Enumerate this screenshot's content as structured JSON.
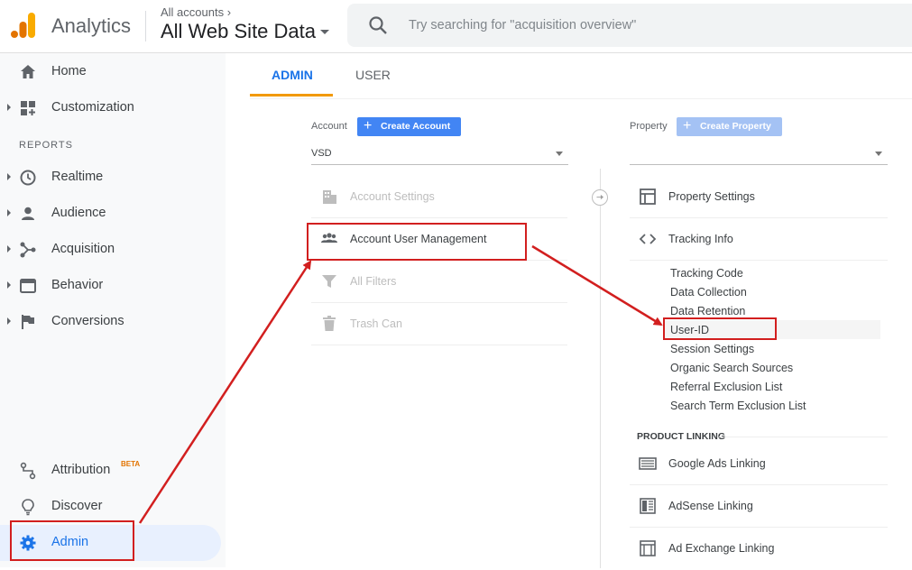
{
  "header": {
    "app_name": "Analytics",
    "account_crumb": "All accounts ›",
    "account_name": "All Web Site Data",
    "search_placeholder": "Try searching for \"acquisition overview\""
  },
  "sidebar": {
    "items": [
      {
        "label": "Home",
        "icon": "home-icon"
      },
      {
        "label": "Customization",
        "icon": "customization-icon"
      }
    ],
    "reports_label": "REPORTS",
    "reports": [
      {
        "label": "Realtime",
        "icon": "clock-icon"
      },
      {
        "label": "Audience",
        "icon": "person-icon"
      },
      {
        "label": "Acquisition",
        "icon": "acquisition-icon"
      },
      {
        "label": "Behavior",
        "icon": "behavior-icon"
      },
      {
        "label": "Conversions",
        "icon": "flag-icon"
      }
    ],
    "bottom": [
      {
        "label": "Attribution",
        "badge": "BETA",
        "icon": "attribution-icon"
      },
      {
        "label": "Discover",
        "icon": "lightbulb-icon"
      },
      {
        "label": "Admin",
        "icon": "gear-icon"
      }
    ]
  },
  "tabs": {
    "admin": "ADMIN",
    "user": "USER"
  },
  "account_column": {
    "label": "Account",
    "create_button": "Create Account",
    "selected": "VSD",
    "rows": [
      {
        "label": "Account Settings",
        "enabled": false
      },
      {
        "label": "Account User Management",
        "enabled": true
      },
      {
        "label": "All Filters",
        "enabled": false
      },
      {
        "label": "Trash Can",
        "enabled": false
      }
    ]
  },
  "property_column": {
    "label": "Property",
    "create_button": "Create Property",
    "selected": "",
    "rows": [
      {
        "label": "Property Settings"
      },
      {
        "label": "Tracking Info"
      }
    ],
    "tracking_items": [
      "Tracking Code",
      "Data Collection",
      "Data Retention",
      "User-ID",
      "Session Settings",
      "Organic Search Sources",
      "Referral Exclusion List",
      "Search Term Exclusion List"
    ],
    "product_linking_label": "PRODUCT LINKING",
    "linking_rows": [
      {
        "label": "Google Ads Linking"
      },
      {
        "label": "AdSense Linking"
      },
      {
        "label": "Ad Exchange Linking"
      }
    ]
  },
  "colors": {
    "accent_blue": "#1a73e8",
    "annotation_red": "#d21f1f",
    "tab_underline": "#f29900"
  }
}
